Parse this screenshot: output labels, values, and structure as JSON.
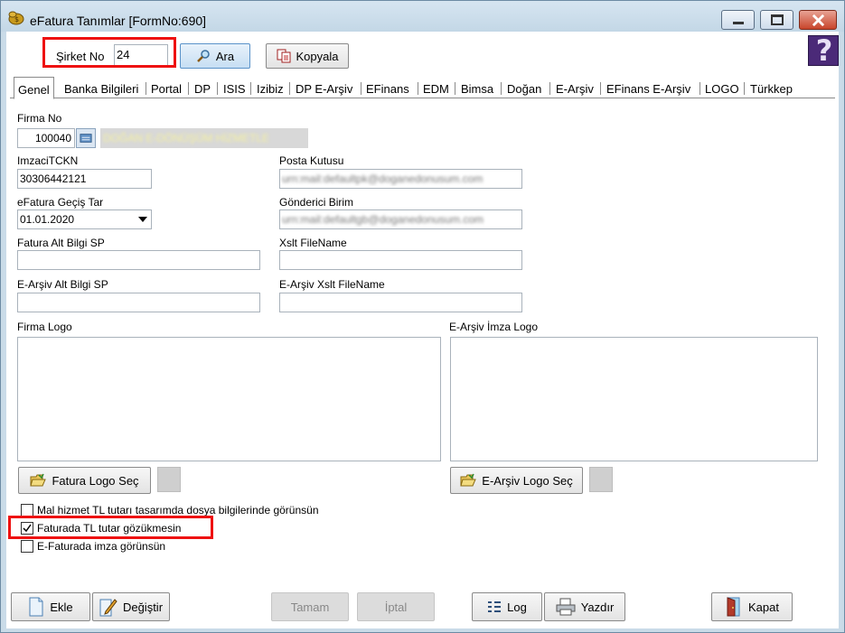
{
  "window": {
    "title": "eFatura Tanımlar [FormNo:690]"
  },
  "toolbar": {
    "sirket_label": "Şirket No",
    "sirket_value": "24",
    "ara_label": "Ara",
    "kopyala_label": "Kopyala"
  },
  "tabs": [
    "Genel",
    "Banka Bilgileri",
    "Portal",
    "DP",
    "ISIS",
    "Izibiz",
    "DP E-Arşiv",
    "EFinans",
    "EDM",
    "Bimsa",
    "Doğan",
    "E-Arşiv",
    "EFinans E-Arşiv",
    "LOGO",
    "Türkkep"
  ],
  "form": {
    "firma_no_label": "Firma No",
    "firma_no_value": "100040",
    "firma_name_value": "DOĞAN E-DÖNÜŞÜM HİZMETLE",
    "imzaci_label": "ImzaciTCKN",
    "imzaci_value": "30306442121",
    "posta_label": "Posta Kutusu",
    "posta_value": "urn:mail:defaultpk@doganedonusum.com",
    "gecis_label": "eFatura Geçiş Tar",
    "gecis_value": "01.01.2020",
    "gonderici_label": "Gönderici Birim",
    "gonderici_value": "urn:mail:defaultgb@doganedonusum.com",
    "fatura_alt_label": "Fatura Alt Bilgi SP",
    "fatura_alt_value": "",
    "xslt_label": "Xslt FileName",
    "xslt_value": "",
    "earsiv_alt_label": "E-Arşiv Alt Bilgi SP",
    "earsiv_alt_value": "",
    "earsiv_xslt_label": "E-Arşiv Xslt FileName",
    "earsiv_xslt_value": "",
    "firma_logo_label": "Firma Logo",
    "imza_logo_label": "E-Arşiv İmza Logo",
    "fatura_logo_btn": "Fatura Logo Seç",
    "earsiv_logo_btn": "E-Arşiv Logo Seç"
  },
  "checkboxes": [
    {
      "label": "Mal hizmet TL tutarı tasarımda dosya bilgilerinde görünsün",
      "checked": false
    },
    {
      "label": "Faturada TL tutar gözükmesin",
      "checked": true
    },
    {
      "label": "E-Faturada imza görünsün",
      "checked": false
    }
  ],
  "bottom": {
    "ekle": "Ekle",
    "degistir": "Değiştir",
    "tamam": "Tamam",
    "iptal": "İptal",
    "log": "Log",
    "yazdir": "Yazdır",
    "kapat": "Kapat"
  },
  "colors": {
    "highlight": "#ee1111",
    "title_bg": "#c9dbe8",
    "help_bg": "#4b2a78"
  }
}
